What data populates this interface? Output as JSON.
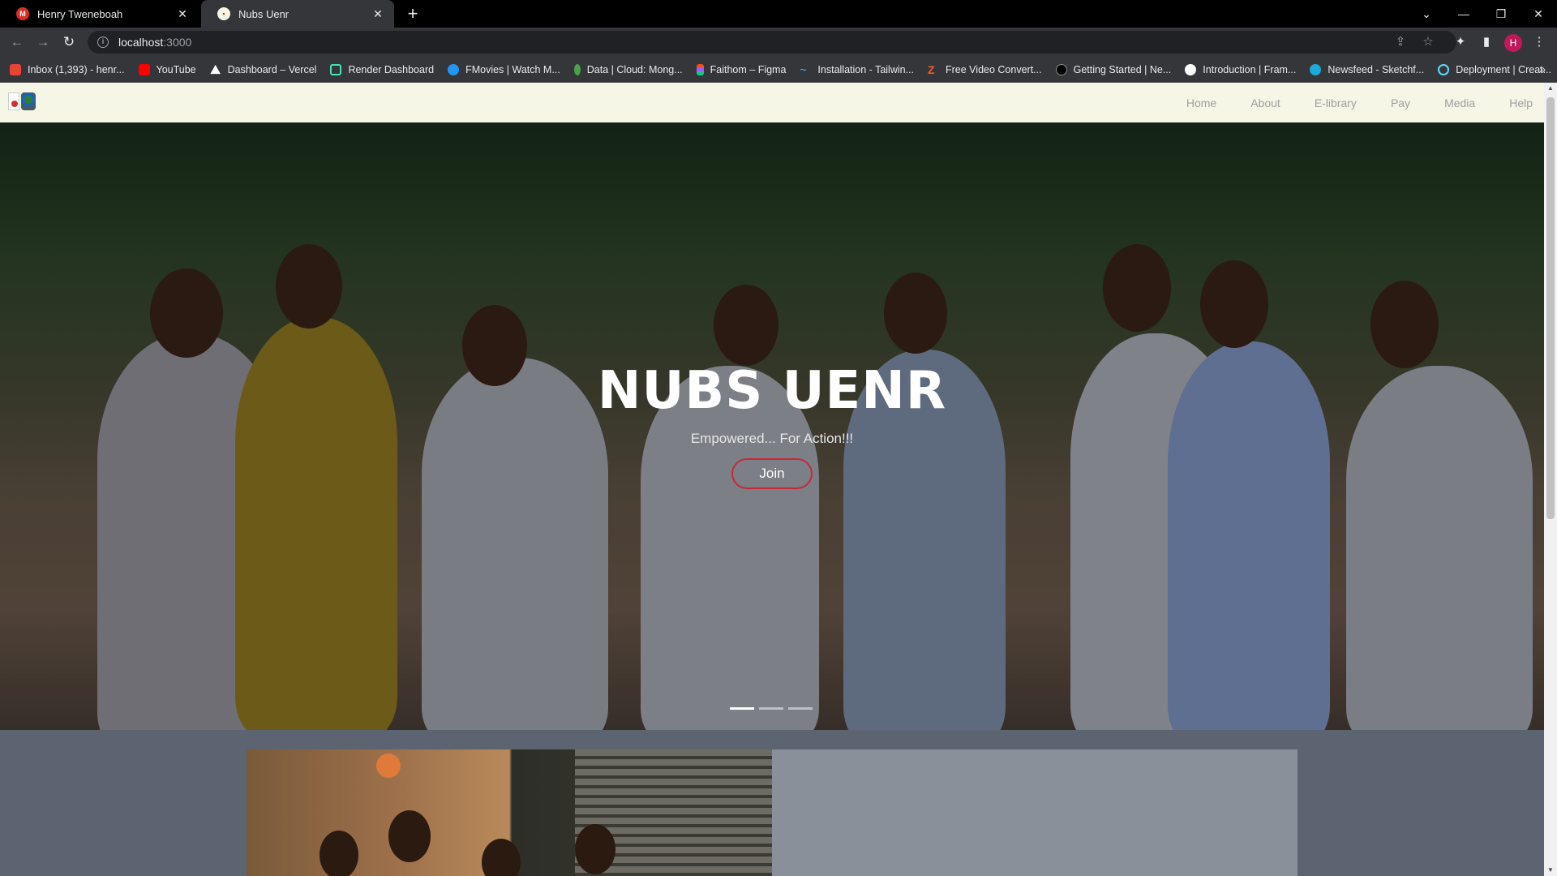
{
  "browser": {
    "tabs": [
      {
        "title": "Henry Tweneboah",
        "active": false,
        "favicon_color": "#d93025"
      },
      {
        "title": "Nubs Uenr",
        "active": true,
        "favicon_color": "#ffffff"
      }
    ],
    "url": {
      "host": "localhost",
      "port": ":3000"
    },
    "profile_initial": "H",
    "bookmarks": [
      {
        "label": "Inbox (1,393) - henr...",
        "icon": "gmail-icon",
        "color": "#ea4335"
      },
      {
        "label": "YouTube",
        "icon": "youtube-icon",
        "color": "#ff0000"
      },
      {
        "label": "Dashboard – Vercel",
        "icon": "vercel-icon",
        "color": "#ffffff"
      },
      {
        "label": "Render Dashboard",
        "icon": "render-icon",
        "color": "#46e3b7"
      },
      {
        "label": "FMovies | Watch M...",
        "icon": "fmovies-icon",
        "color": "#2196f3"
      },
      {
        "label": "Data | Cloud: Mong...",
        "icon": "mongodb-icon",
        "color": "#47a248"
      },
      {
        "label": "Faithom – Figma",
        "icon": "figma-icon",
        "color": "#f24e1e"
      },
      {
        "label": "Installation - Tailwin...",
        "icon": "tailwind-icon",
        "color": "#38bdf8"
      },
      {
        "label": "Free Video Convert...",
        "icon": "converter-icon",
        "color": "#ff5722"
      },
      {
        "label": "Getting Started | Ne...",
        "icon": "nextjs-icon",
        "color": "#000000"
      },
      {
        "label": "Introduction | Fram...",
        "icon": "framer-icon",
        "color": "#ffffff"
      },
      {
        "label": "Newsfeed - Sketchf...",
        "icon": "sketchfab-icon",
        "color": "#1caad9"
      },
      {
        "label": "Deployment | Creat...",
        "icon": "react-icon",
        "color": "#61dafb"
      }
    ]
  },
  "site": {
    "nav": [
      "Home",
      "About",
      "E-library",
      "Pay",
      "Media",
      "Help"
    ],
    "hero": {
      "title": "NUBS UENR",
      "subtitle": "Empowered... For Action!!!",
      "cta": "Join",
      "slides": 3,
      "active_slide": 1
    }
  }
}
